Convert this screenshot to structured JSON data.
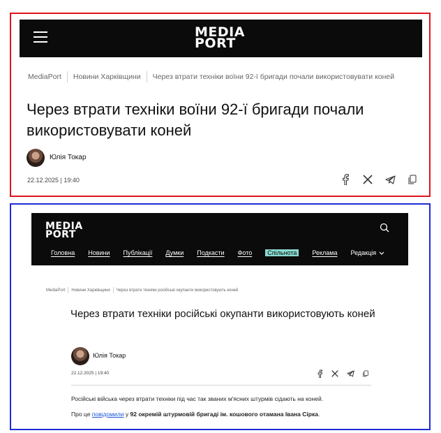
{
  "colors": {
    "top_frame": "#e0141b",
    "bottom_frame": "#1d2bd6",
    "header_bg": "#0b0b0b",
    "nav_active_bg": "#8adad0",
    "link": "#1d57d9"
  },
  "top": {
    "logo": {
      "line1": "MEDIA",
      "line2": "PORT"
    },
    "menu_icon": "hamburger-menu-icon",
    "breadcrumbs": [
      "MediaPort",
      "Новини Харківщини",
      "Через втрати техніки воїни 92-ї бригади почали використовувати коней"
    ],
    "title": "Через втрати техніки воїни 92-ї бригади почали використовувати коней",
    "author": "Юлія Токар",
    "date": "22.12.2025 | 19:40",
    "share_icons": [
      "facebook-icon",
      "x-icon",
      "telegram-icon",
      "copy-icon"
    ]
  },
  "bottom": {
    "logo": {
      "line1": "MEDIA",
      "line2": "PORT"
    },
    "search_icon": "search-icon",
    "nav": [
      {
        "label": "Головна",
        "active": false
      },
      {
        "label": "Новини",
        "active": false
      },
      {
        "label": "Публікації",
        "active": false
      },
      {
        "label": "Думки",
        "active": false
      },
      {
        "label": "Подкасти",
        "active": false
      },
      {
        "label": "Фото",
        "active": false
      },
      {
        "label": "Спільнота",
        "active": true
      },
      {
        "label": "Реклама",
        "active": false
      },
      {
        "label": "Редакція",
        "active": false,
        "dropdown": true
      }
    ],
    "breadcrumbs": [
      "MediaPort",
      "Новини Харківщини",
      "Через втрати техніки російські окупанти використовують коней"
    ],
    "title": "Через втрати техніки російські окупанти використовують коней",
    "author": "Юлія Токар",
    "date": "22.12.2025 | 19:40",
    "share_icons": [
      "facebook-icon",
      "x-icon",
      "telegram-icon",
      "copy-icon"
    ],
    "paragraph1": "Російські війська через втрати техніки під час так званих м'ясних штурмів сідають на коней.",
    "paragraph2": {
      "prefix": "Про це ",
      "link": "повідомили",
      "middle": " у ",
      "bold": "92 окремій штурмовій бригаді ім. кошового отамана Івана Сірка",
      "suffix": "."
    }
  }
}
